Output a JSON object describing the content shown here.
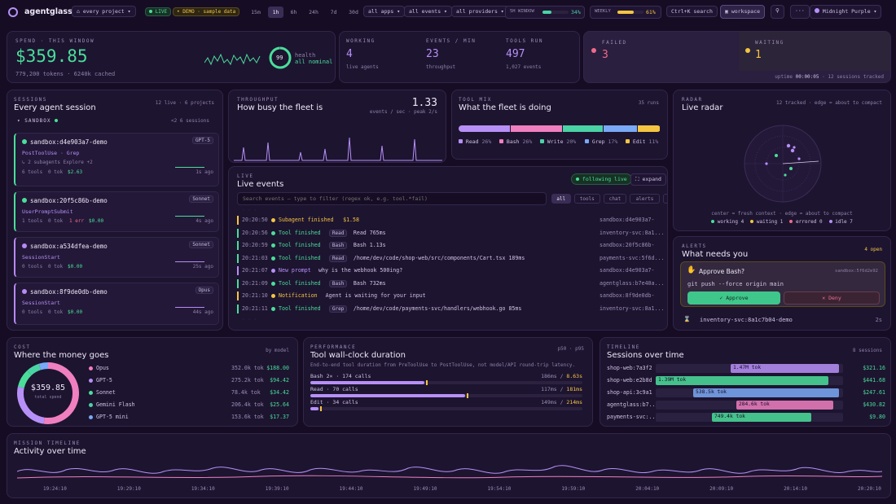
{
  "topbar": {
    "brand": "agentglass",
    "project": "every project",
    "live": "LIVE",
    "demo": "DEMO · sample data",
    "ranges": [
      "15m",
      "1h",
      "6h",
      "24h",
      "7d",
      "30d",
      "all"
    ],
    "active_range": "1h",
    "apps": "all apps",
    "events": "all events",
    "providers": "all providers",
    "window_label": "5H WINDOW",
    "window_pct": "34%",
    "window_val": 34,
    "weekly_label": "WEEKLY",
    "weekly_pct": "61%",
    "weekly_val": 61,
    "search": "Ctrl+K search",
    "workspace": "workspace",
    "more": "···",
    "theme": "Midnight Purple"
  },
  "spend": {
    "label": "SPEND · THIS WINDOW",
    "amount": "$359.85",
    "tokens": "779,200 tokens",
    "cached": "6240k cached",
    "health_score": "99",
    "health_label": "health",
    "health_status": "all nominal"
  },
  "kpis": [
    {
      "label": "WORKING",
      "value": "4",
      "sub": "live agents"
    },
    {
      "label": "EVENTS / MIN",
      "value": "23",
      "sub": "throughput"
    },
    {
      "label": "TOOLS RUN",
      "value": "497",
      "sub": "1,027 events"
    }
  ],
  "alerts_top": {
    "failed_label": "FAILED",
    "failed": "3",
    "waiting_label": "WAITING",
    "waiting": "1",
    "uptime_label": "uptime",
    "uptime": "00:00:05",
    "tracked": "12 sessions tracked"
  },
  "sessions": {
    "label": "SESSIONS",
    "title": "Every agent session",
    "count": "12 live · 6 projects",
    "group": "SANDBOX",
    "group_count": "<2  6 sessions",
    "items": [
      {
        "name": "sandbox:d4e903a7-demo",
        "model": "GPT-5",
        "event": "PostToolUse · Grep",
        "sub": "↳ 2 subagents Explore +2",
        "tools": "6 tools",
        "tok": "0 tok",
        "err": "",
        "cost": "$2.63",
        "age": "1s ago",
        "color": "#4ade9a"
      },
      {
        "name": "sandbox:20f5c86b-demo",
        "model": "Sonnet",
        "event": "UserPromptSubmit",
        "sub": "",
        "tools": "1 tools",
        "tok": "0 tok",
        "err": "1 err",
        "cost": "$0.00",
        "age": "4s ago",
        "color": "#4ade9a"
      },
      {
        "name": "sandbox:a534dfea-demo",
        "model": "Sonnet",
        "event": "SessionStart",
        "sub": "",
        "tools": "0 tools",
        "tok": "0 tok",
        "err": "",
        "cost": "$0.00",
        "age": "25s ago",
        "color": "#b78af5"
      },
      {
        "name": "sandbox:8f9de0db-demo",
        "model": "Opus",
        "event": "SessionStart",
        "sub": "",
        "tools": "0 tools",
        "tok": "0 tok",
        "err": "",
        "cost": "$0.00",
        "age": "44s ago",
        "color": "#b78af5"
      }
    ]
  },
  "throughput": {
    "label": "THROUGHPUT",
    "title": "How busy the fleet is",
    "value": "1.33",
    "sub": "events / sec · peak 2/s"
  },
  "toolmix": {
    "label": "TOOL MIX",
    "title": "What the fleet is doing",
    "runs": "35 runs",
    "items": [
      {
        "name": "Read",
        "pct": "26%",
        "val": 26,
        "color": "#b690f7"
      },
      {
        "name": "Bash",
        "pct": "26%",
        "val": 26,
        "color": "#f07fc0"
      },
      {
        "name": "Write",
        "pct": "20%",
        "val": 20,
        "color": "#4ad3a4"
      },
      {
        "name": "Grep",
        "pct": "17%",
        "val": 17,
        "color": "#7aa9f5"
      },
      {
        "name": "Edit",
        "pct": "11%",
        "val": 11,
        "color": "#f5c542"
      }
    ]
  },
  "radar": {
    "label": "RADAR",
    "title": "Live radar",
    "sub": "12 tracked · edge = about to compact",
    "legend": "center = fresh context · edge = about to compact",
    "states": [
      {
        "name": "working",
        "n": "4",
        "color": "#4ade9a"
      },
      {
        "name": "waiting",
        "n": "1",
        "color": "#f5c542"
      },
      {
        "name": "errored",
        "n": "0",
        "color": "#f06a8a"
      },
      {
        "name": "idle",
        "n": "7",
        "color": "#b690f7"
      }
    ]
  },
  "live": {
    "label": "LIVE",
    "title": "Live events",
    "following": "following live",
    "expand": "expand",
    "search_placeholder": "Search events — type to filter (regex ok, e.g. tool.*fail)",
    "filters": [
      "all",
      "tools",
      "chat",
      "alerts",
      "lanes"
    ],
    "rows": [
      {
        "time": "20:20:50",
        "color": "#f5c542",
        "type": "Subagent finished",
        "tag": "",
        "detail": "$1.58",
        "detail_color": "#f5c542",
        "session": "sandbox:d4e903a7-"
      },
      {
        "time": "20:20:56",
        "color": "#4ade9a",
        "type": "Tool finished",
        "tag": "Read",
        "detail": "Read 765ms",
        "detail_color": "#cfc3e3",
        "session": "inventory-svc:8a1..."
      },
      {
        "time": "20:20:59",
        "color": "#4ade9a",
        "type": "Tool finished",
        "tag": "Bash",
        "detail": "Bash 1.13s",
        "detail_color": "#cfc3e3",
        "session": "sandbox:20f5c86b-"
      },
      {
        "time": "20:21:03",
        "color": "#4ade9a",
        "type": "Tool finished",
        "tag": "Read",
        "detail": "/home/dev/code/shop-web/src/components/Cart.tsx 189ms",
        "detail_color": "#cfc3e3",
        "session": "payments-svc:5f6d..."
      },
      {
        "time": "20:21:07",
        "color": "#b690f7",
        "type": "New prompt",
        "tag": "",
        "detail": "why is the webhook 500ing?",
        "detail_color": "#cfc3e3",
        "session": "sandbox:d4e903a7-"
      },
      {
        "time": "20:21:09",
        "color": "#4ade9a",
        "type": "Tool finished",
        "tag": "Bash",
        "detail": "Bash 732ms",
        "detail_color": "#cfc3e3",
        "session": "agentglass:b7e40a..."
      },
      {
        "time": "20:21:10",
        "color": "#f5c542",
        "type": "Notification",
        "tag": "",
        "detail": "Agent is waiting for your input",
        "detail_color": "#cfc3e3",
        "session": "sandbox:8f9de0db-"
      },
      {
        "time": "20:21:11",
        "color": "#4ade9a",
        "type": "Tool finished",
        "tag": "Grep",
        "detail": "/home/dev/code/payments-svc/handlers/webhook.go 85ms",
        "detail_color": "#cfc3e3",
        "session": "inventory-svc:8a1..."
      }
    ]
  },
  "alerts": {
    "label": "ALERTS",
    "title": "What needs you",
    "count": "4 open",
    "approve_title": "Approve Bash?",
    "approve_session": "sandbox:5f6d2e92",
    "command": "git push --force origin main",
    "approve": "✓ Approve",
    "deny": "✕ Deny",
    "next": "inventory-svc:8a1c7b04-demo",
    "next_age": "2s"
  },
  "cost": {
    "label": "COST",
    "title": "Where the money goes",
    "by": "by model",
    "total": "$359.85",
    "total_label": "total spend",
    "items": [
      {
        "name": "Opus",
        "tok": "352.0k tok",
        "cost": "$188.00",
        "color": "#f07fc0",
        "val": 188.0
      },
      {
        "name": "GPT-5",
        "tok": "275.2k tok",
        "cost": "$94.42",
        "color": "#b690f7",
        "val": 94.42
      },
      {
        "name": "Sonnet",
        "tok": "78.4k tok",
        "cost": "$34.42",
        "color": "#4ade9a",
        "val": 34.42
      },
      {
        "name": "Gemini Flash",
        "tok": "206.4k tok",
        "cost": "$25.64",
        "color": "#4ad3a4",
        "val": 25.64
      },
      {
        "name": "GPT-5 mini",
        "tok": "153.6k tok",
        "cost": "$17.37",
        "color": "#7aa9f5",
        "val": 17.37
      }
    ]
  },
  "perf": {
    "label": "PERFORMANCE",
    "title": "Tool wall-clock duration",
    "pct": "p50 · p95",
    "desc": "End-to-end tool duration from PreToolUse to PostToolUse, not model/API round-trip latency.",
    "items": [
      {
        "name": "Bash 2×",
        "calls": "174 calls",
        "p50": "186ms",
        "p95": "8.63s",
        "frac": 0.42
      },
      {
        "name": "Read",
        "calls": "70 calls",
        "p50": "117ms",
        "p95": "181ms",
        "frac": 0.57
      },
      {
        "name": "Edit",
        "calls": "34 calls",
        "p50": "149ms",
        "p95": "214ms",
        "frac": 0.03
      }
    ]
  },
  "timeline": {
    "label": "TIMELINE",
    "title": "Sessions over time",
    "count": "8 sessions",
    "items": [
      {
        "name": "shop-web:7a3f2",
        "tok": "1.47M tok",
        "cost": "$321.16",
        "color": "#b690f7",
        "start": 0.4,
        "end": 0.98
      },
      {
        "name": "shop-web:e2b8d",
        "tok": "1.39M tok",
        "cost": "$441.68",
        "color": "#4ade9a",
        "start": 0.0,
        "end": 0.92
      },
      {
        "name": "shop-api:3c9a1",
        "tok": "538.5k tok",
        "cost": "$247.61",
        "color": "#7aa9f5",
        "start": 0.2,
        "end": 0.98
      },
      {
        "name": "agentglass:b7...",
        "tok": "284.6k tok",
        "cost": "$430.82",
        "color": "#f07fc0",
        "start": 0.43,
        "end": 0.95
      },
      {
        "name": "payments-svc:...",
        "tok": "749.4k tok",
        "cost": "$9.80",
        "color": "#4ade9a",
        "start": 0.3,
        "end": 0.83
      }
    ]
  },
  "mission": {
    "label": "MISSION TIMELINE",
    "title": "Activity over time",
    "ticks": [
      "19:24:10",
      "19:29:10",
      "19:34:10",
      "19:39:10",
      "19:44:10",
      "19:49:10",
      "19:54:10",
      "19:59:10",
      "20:04:10",
      "20:09:10",
      "20:14:10",
      "20:20:10"
    ]
  }
}
